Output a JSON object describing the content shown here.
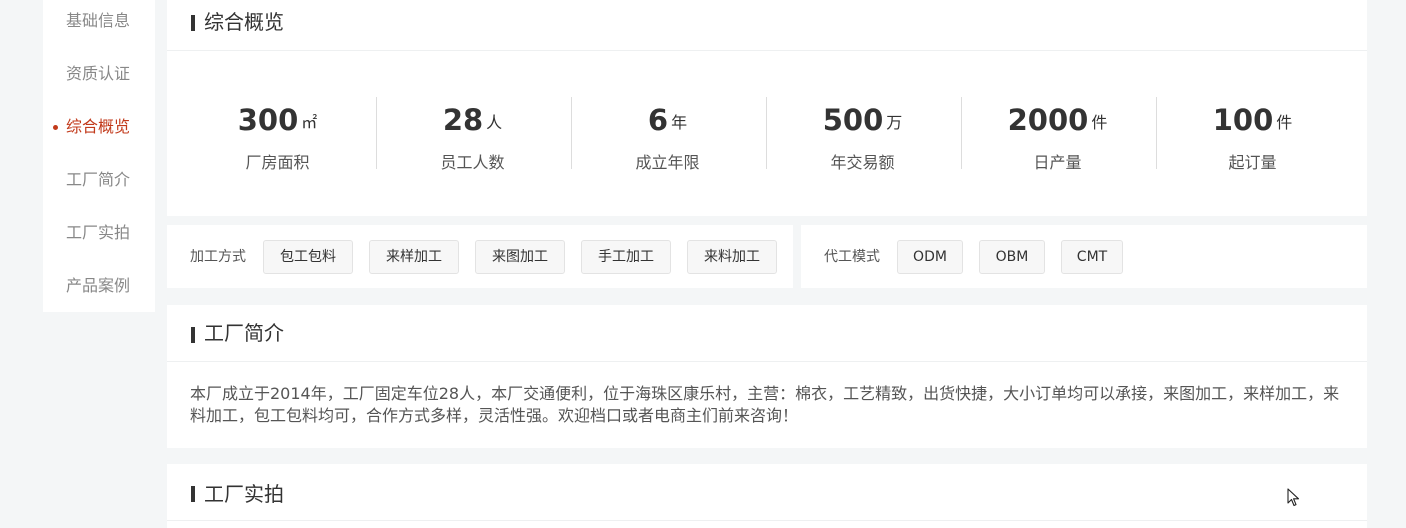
{
  "sidebar": {
    "items": [
      {
        "label": "基础信息"
      },
      {
        "label": "资质认证"
      },
      {
        "label": "综合概览"
      },
      {
        "label": "工厂简介"
      },
      {
        "label": "工厂实拍"
      },
      {
        "label": "产品案例"
      }
    ],
    "active_index": 2
  },
  "overview": {
    "title": "综合概览",
    "stats": [
      {
        "value": "300",
        "unit": "㎡",
        "label": "厂房面积"
      },
      {
        "value": "28",
        "unit": "人",
        "label": "员工人数"
      },
      {
        "value": "6",
        "unit": "年",
        "label": "成立年限"
      },
      {
        "value": "500",
        "unit": "万",
        "label": "年交易额"
      },
      {
        "value": "2000",
        "unit": "件",
        "label": "日产量"
      },
      {
        "value": "100",
        "unit": "件",
        "label": "起订量"
      }
    ]
  },
  "processing": {
    "label": "加工方式",
    "tags": [
      "包工包料",
      "来样加工",
      "来图加工",
      "手工加工",
      "来料加工"
    ]
  },
  "oem": {
    "label": "代工模式",
    "tags": [
      "ODM",
      "OBM",
      "CMT"
    ]
  },
  "intro": {
    "title": "工厂简介",
    "text": "本厂成立于2014年，工厂固定车位28人，本厂交通便利，位于海珠区康乐村，主营：棉衣，工艺精致，出货快捷，大小订单均可以承接，来图加工，来样加工，来料加工，包工包料均可，合作方式多样，灵活性强。欢迎档口或者电商主们前来咨询！"
  },
  "photos": {
    "title": "工厂实拍"
  },
  "colors": {
    "accent": "#c23a1b",
    "background": "#f4f6f7"
  }
}
